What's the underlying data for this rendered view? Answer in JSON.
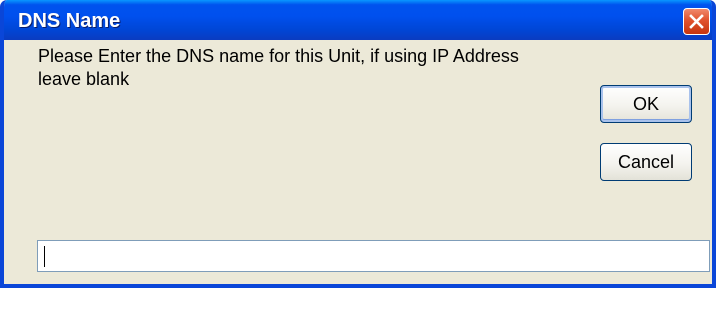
{
  "window": {
    "title": "DNS Name"
  },
  "dialog": {
    "message": "Please Enter the DNS name for this Unit, if using IP Address leave blank",
    "ok_label": "OK",
    "cancel_label": "Cancel",
    "input_value": ""
  },
  "icons": {
    "close": "close-icon"
  },
  "colors": {
    "titlebar": "#0053EE",
    "dialog_background": "#ECE9D8",
    "close_button": "#E0522E",
    "input_border": "#7F9DB9",
    "button_border": "#003C74"
  }
}
